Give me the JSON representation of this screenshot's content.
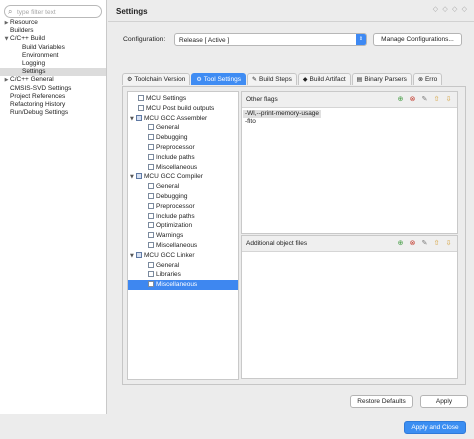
{
  "filter": {
    "placeholder": "type filter text"
  },
  "nav": {
    "items": [
      {
        "label": "Resource",
        "toggle": "▶",
        "indent": 0
      },
      {
        "label": "Builders",
        "toggle": "",
        "indent": 0
      },
      {
        "label": "C/C++ Build",
        "toggle": "▼",
        "indent": 0
      },
      {
        "label": "Build Variables",
        "toggle": "",
        "indent": 1
      },
      {
        "label": "Environment",
        "toggle": "",
        "indent": 1
      },
      {
        "label": "Logging",
        "toggle": "",
        "indent": 1
      },
      {
        "label": "Settings",
        "toggle": "",
        "indent": 1,
        "selected": true
      },
      {
        "label": "C/C++ General",
        "toggle": "▶",
        "indent": 0
      },
      {
        "label": "CMSIS-SVD Settings",
        "toggle": "",
        "indent": 0
      },
      {
        "label": "Project References",
        "toggle": "",
        "indent": 0
      },
      {
        "label": "Refactoring History",
        "toggle": "",
        "indent": 0
      },
      {
        "label": "Run/Debug Settings",
        "toggle": "",
        "indent": 0
      }
    ]
  },
  "header": {
    "title": "Settings",
    "nav_arrows": "◇ ◇ ◇ ◇"
  },
  "configuration": {
    "label": "Configuration:",
    "value": "Release  [ Active ]",
    "manage_button": "Manage Configurations..."
  },
  "tabs": [
    {
      "label": "Toolchain Version",
      "icon": "⚙",
      "icon_name": "toolchain-icon"
    },
    {
      "label": "Tool Settings",
      "icon": "⚙",
      "icon_name": "tool-settings-icon",
      "active": true
    },
    {
      "label": "Build Steps",
      "icon": "✎",
      "icon_name": "build-steps-icon"
    },
    {
      "label": "Build Artifact",
      "icon": "◆",
      "icon_name": "build-artifact-icon"
    },
    {
      "label": "Binary Parsers",
      "icon": "▤",
      "icon_name": "binary-parsers-icon"
    },
    {
      "label": "Erro",
      "icon": "⊗",
      "icon_name": "error-parsers-icon"
    }
  ],
  "tool_tree": [
    {
      "label": "MCU Settings",
      "level": 1,
      "toggle": ""
    },
    {
      "label": "MCU Post build outputs",
      "level": 1,
      "toggle": ""
    },
    {
      "label": "MCU GCC Assembler",
      "level": 0,
      "toggle": "▼"
    },
    {
      "label": "General",
      "level": 2,
      "toggle": ""
    },
    {
      "label": "Debugging",
      "level": 2,
      "toggle": ""
    },
    {
      "label": "Preprocessor",
      "level": 2,
      "toggle": ""
    },
    {
      "label": "Include paths",
      "level": 2,
      "toggle": ""
    },
    {
      "label": "Miscellaneous",
      "level": 2,
      "toggle": ""
    },
    {
      "label": "MCU GCC Compiler",
      "level": 0,
      "toggle": "▼"
    },
    {
      "label": "General",
      "level": 2,
      "toggle": ""
    },
    {
      "label": "Debugging",
      "level": 2,
      "toggle": ""
    },
    {
      "label": "Preprocessor",
      "level": 2,
      "toggle": ""
    },
    {
      "label": "Include paths",
      "level": 2,
      "toggle": ""
    },
    {
      "label": "Optimization",
      "level": 2,
      "toggle": ""
    },
    {
      "label": "Warnings",
      "level": 2,
      "toggle": ""
    },
    {
      "label": "Miscellaneous",
      "level": 2,
      "toggle": ""
    },
    {
      "label": "MCU GCC Linker",
      "level": 0,
      "toggle": "▼"
    },
    {
      "label": "General",
      "level": 2,
      "toggle": ""
    },
    {
      "label": "Libraries",
      "level": 2,
      "toggle": ""
    },
    {
      "label": "Miscellaneous",
      "level": 2,
      "toggle": "",
      "selected": true
    }
  ],
  "other_flags": {
    "label": "Other flags",
    "values": [
      "-Wl,--print-memory-usage",
      "-flto"
    ]
  },
  "additional_objects": {
    "label": "Additional object files"
  },
  "panel_tools": [
    {
      "icon": "⊕",
      "name": "add-icon",
      "color": "#3f9a3f"
    },
    {
      "icon": "⊗",
      "name": "delete-icon",
      "color": "#c33b2e"
    },
    {
      "icon": "✎",
      "name": "edit-icon",
      "color": "#7b7b7b"
    },
    {
      "icon": "⇧",
      "name": "move-up-icon",
      "color": "#d6a13a"
    },
    {
      "icon": "⇩",
      "name": "move-down-icon",
      "color": "#d6a13a"
    }
  ],
  "buttons": {
    "restore_defaults": "Restore Defaults",
    "apply": "Apply",
    "apply_and_close": "Apply and Close"
  },
  "colors": {
    "accent": "#3e87f0"
  }
}
